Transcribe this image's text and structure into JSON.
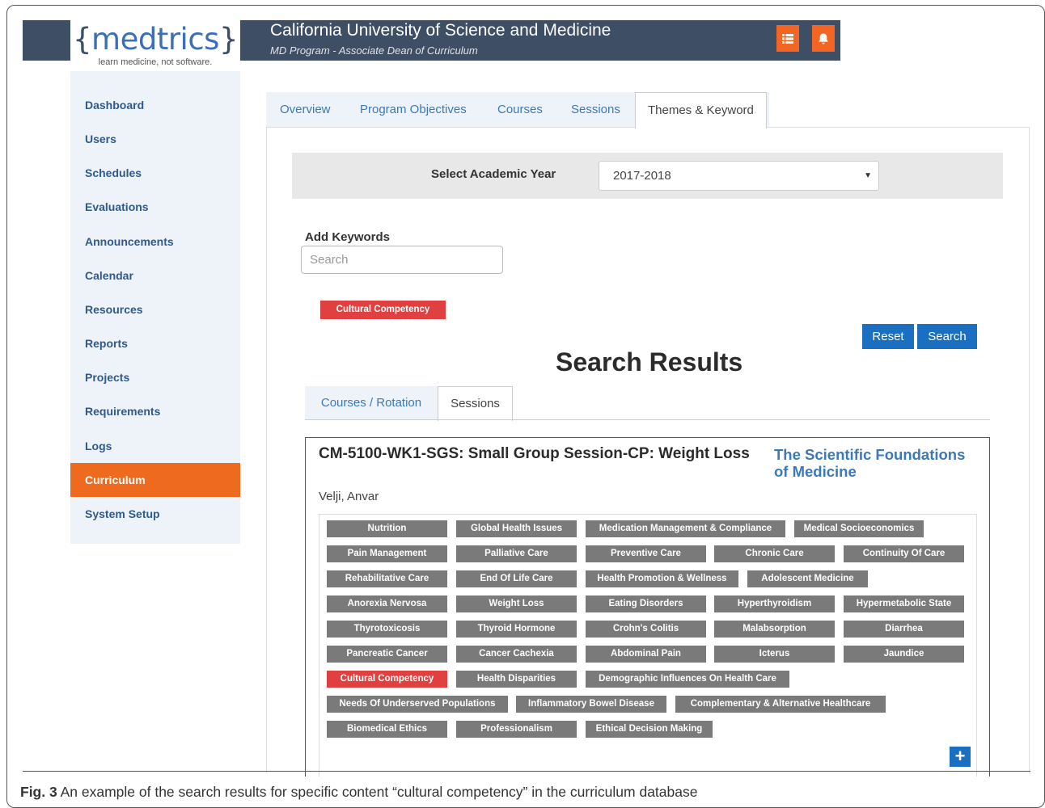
{
  "header": {
    "logo_open": "{",
    "logo_text": "medtrics",
    "logo_close": "}",
    "tagline": "learn medicine, not software.",
    "title": "California University of Science and Medicine",
    "subtitle": "MD Program - Associate Dean of Curriculum",
    "icons": [
      "list-icon",
      "bell-icon"
    ],
    "accent": "#f26522",
    "bar_color": "#3e4e65"
  },
  "sidebar": {
    "items": [
      {
        "label": "Dashboard"
      },
      {
        "label": "Users"
      },
      {
        "label": "Schedules"
      },
      {
        "label": "Evaluations"
      },
      {
        "label": "Announcements"
      },
      {
        "label": "Calendar"
      },
      {
        "label": "Resources"
      },
      {
        "label": "Reports"
      },
      {
        "label": "Projects"
      },
      {
        "label": "Requirements"
      },
      {
        "label": "Logs"
      },
      {
        "label": "Curriculum",
        "active": true
      },
      {
        "label": "System Setup"
      }
    ]
  },
  "main_tabs": [
    {
      "label": "Overview"
    },
    {
      "label": "Program Objectives"
    },
    {
      "label": "Courses"
    },
    {
      "label": "Sessions"
    },
    {
      "label": "Themes & Keyword",
      "active": true
    }
  ],
  "academic_year": {
    "label": "Select Academic Year",
    "selected": "2017-2018"
  },
  "keywords": {
    "label": "Add Keywords",
    "placeholder": "Search",
    "selected_tag": "Cultural Competency"
  },
  "buttons": {
    "reset": "Reset",
    "search": "Search"
  },
  "results": {
    "title": "Search Results",
    "tabs": [
      {
        "label": "Courses / Rotation"
      },
      {
        "label": "Sessions",
        "active": true
      }
    ],
    "session": {
      "title": "CM-5100-WK1-SGS: Small Group Session-CP: Weight Loss",
      "course_line1": "The Scientific Foundations",
      "course_line2": "of Medicine",
      "instructor": "Velji, Anvar",
      "tags": [
        "Nutrition",
        "Global Health Issues",
        "Medication Management & Compliance",
        "Medical Socioeconomics",
        "Pain Management",
        "Palliative Care",
        "Preventive Care",
        "Chronic Care",
        "Continuity Of Care",
        "Rehabilitative Care",
        "End Of Life Care",
        "Health Promotion & Wellness",
        "Adolescent Medicine",
        "Anorexia Nervosa",
        "Weight Loss",
        "Eating Disorders",
        "Hyperthyroidism",
        "Hypermetabolic State",
        "Thyrotoxicosis",
        "Thyroid Hormone",
        "Crohn's Colitis",
        "Malabsorption",
        "Diarrhea",
        "Pancreatic Cancer",
        "Cancer Cachexia",
        "Abdominal Pain",
        "Icterus",
        "Jaundice",
        "Cultural Competency",
        "Health Disparities",
        "Demographic Influences On Health Care",
        "Needs Of Underserved Populations",
        "Inflammatory Bowel Disease",
        "Complementary & Alternative Healthcare",
        "Biomedical Ethics",
        "Professionalism",
        "Ethical Decision Making"
      ],
      "highlighted_tag": "Cultural Competency",
      "add_label": "+"
    }
  },
  "caption": {
    "label": "Fig. 3",
    "text": " An example of the search results for specific content “cultural competency” in the curriculum database"
  }
}
